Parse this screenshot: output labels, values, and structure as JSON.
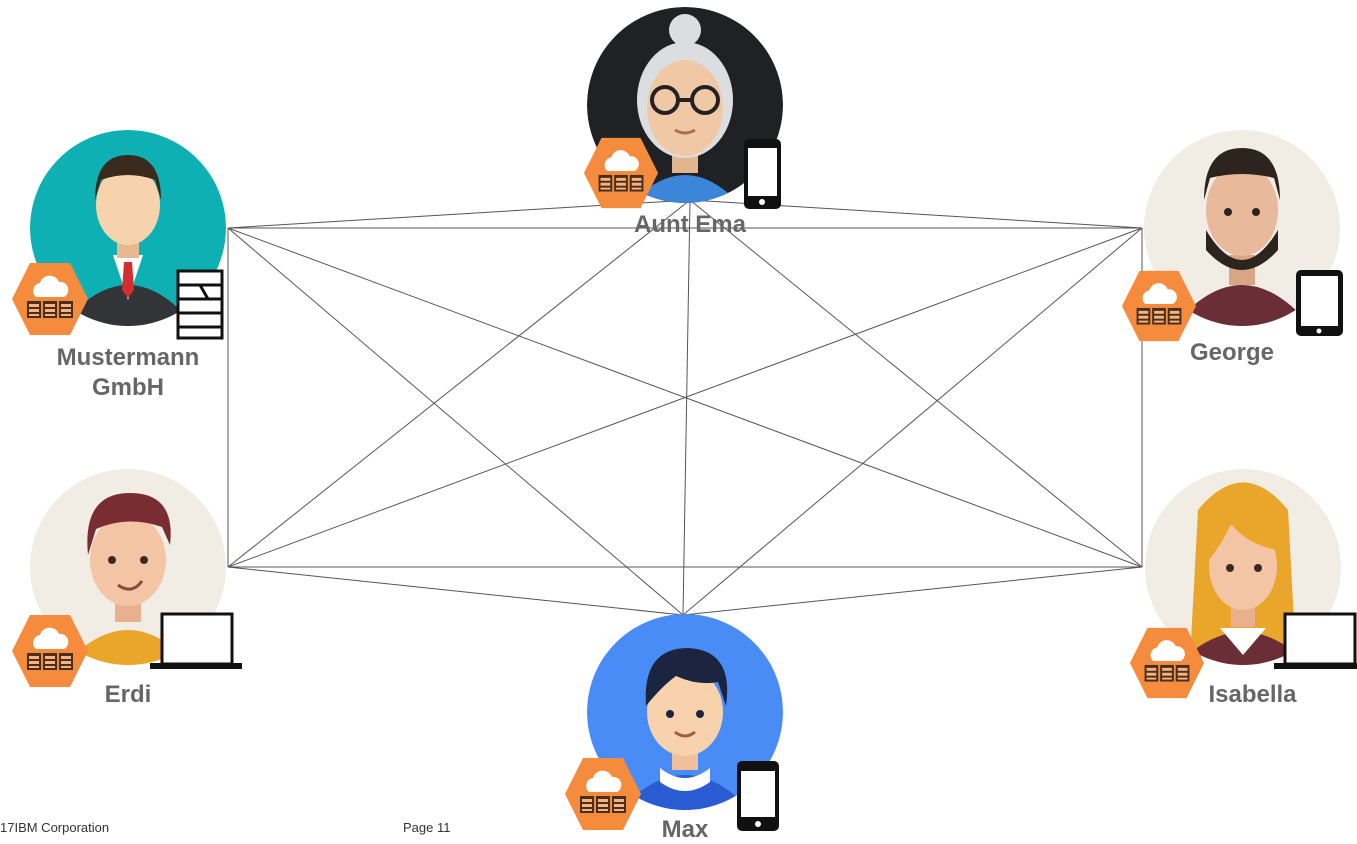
{
  "people": [
    {
      "id": "aunt-ema",
      "name": "Aunt Ema",
      "device": "phone",
      "avatar": "grandmother-avatar",
      "bg_color": "#1f2125"
    },
    {
      "id": "mustermann",
      "name": "Mustermann\nGmbH",
      "device": "server",
      "avatar": "businessman-avatar",
      "bg_color": "#0fb0b4"
    },
    {
      "id": "george",
      "name": "George",
      "device": "tablet",
      "avatar": "bearded-man-avatar",
      "bg_color": "#f1ece4"
    },
    {
      "id": "erdi",
      "name": "Erdi",
      "device": "laptop",
      "avatar": "young-man-avatar",
      "bg_color": "#f1ece4"
    },
    {
      "id": "isabella",
      "name": "Isabella",
      "device": "laptop",
      "avatar": "woman-avatar",
      "bg_color": "#f1ece4"
    },
    {
      "id": "max",
      "name": "Max",
      "device": "phone",
      "avatar": "boy-avatar",
      "bg_color": "#4a8cf5"
    }
  ],
  "badge": {
    "icon": "cloud-server-icon",
    "color": "#f58b3c"
  },
  "footer": {
    "copyright": "17IBM Corporation",
    "page": "Page 11"
  }
}
